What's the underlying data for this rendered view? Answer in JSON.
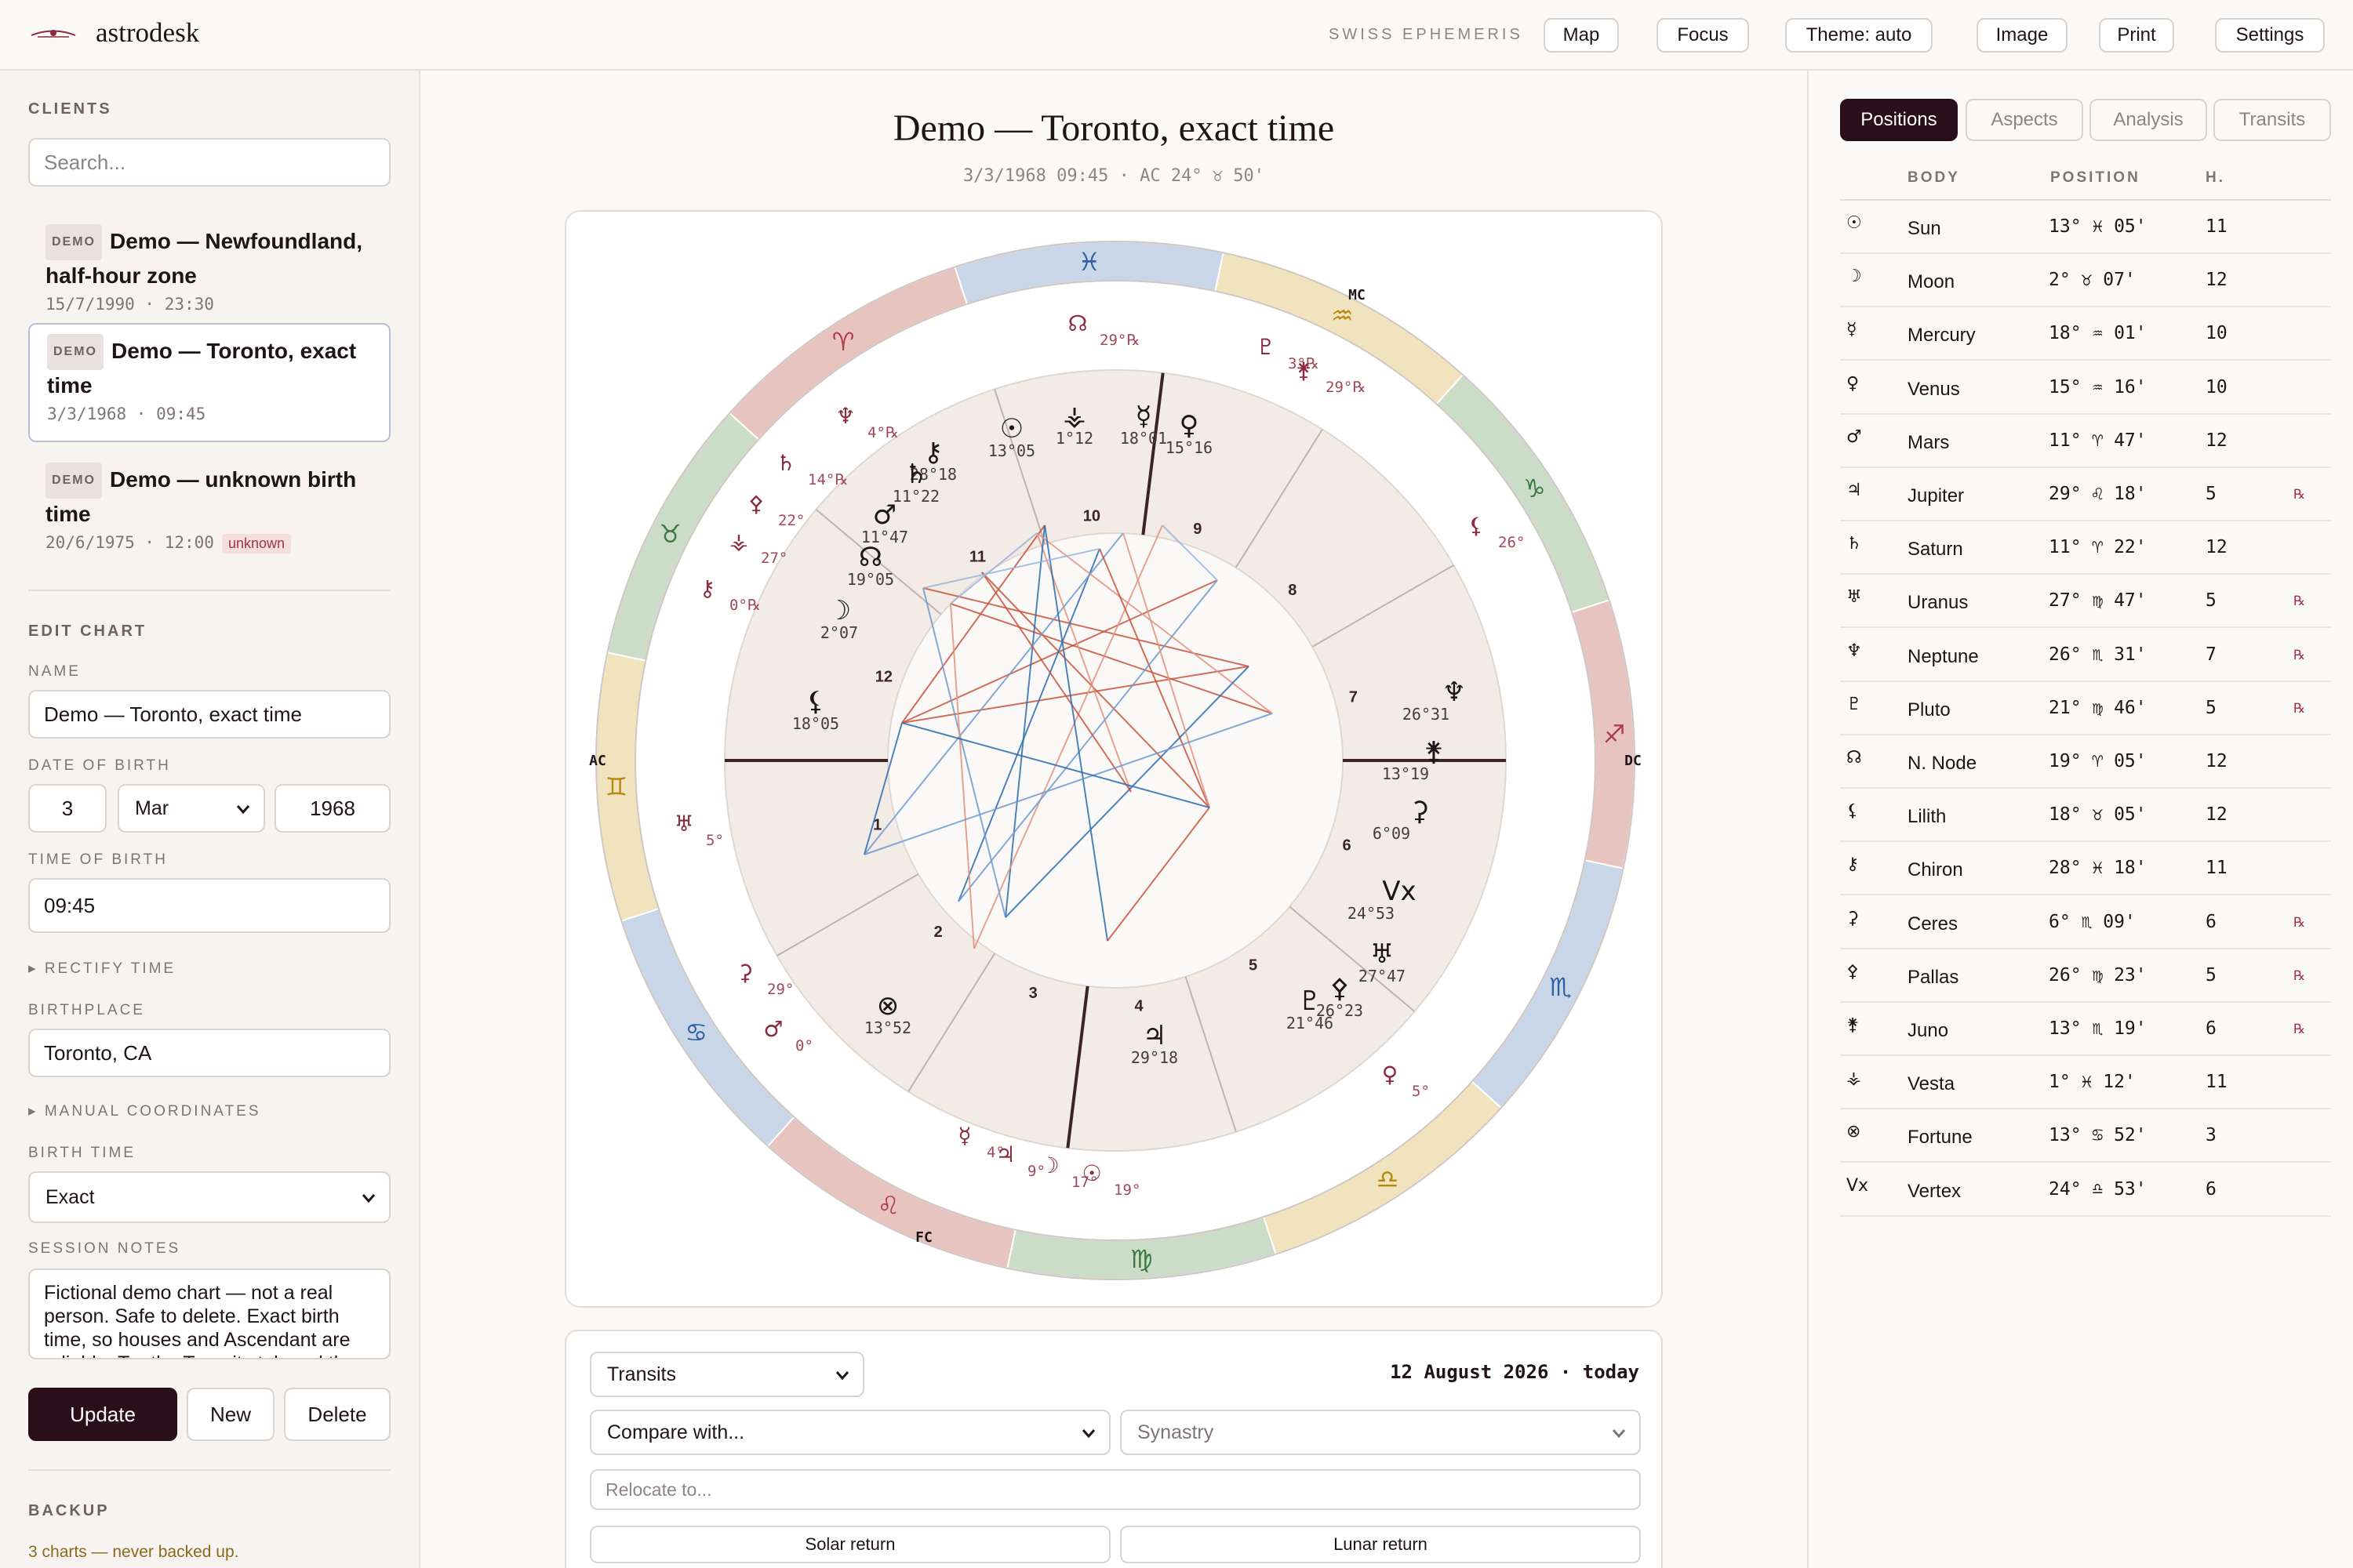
{
  "app": {
    "brand": "astrodesk",
    "ephemeris_label": "SWISS EPHEMERIS"
  },
  "topnav": {
    "map": "Map",
    "focus": "Focus",
    "theme": "Theme: auto",
    "image": "Image",
    "print": "Print",
    "settings": "Settings"
  },
  "sidebar": {
    "clients_title": "CLIENTS",
    "search_placeholder": "Search...",
    "clients": [
      {
        "badge": "DEMO",
        "name": "Demo — Newfoundland, half-hour zone",
        "date": "15/7/1990 · 23:30",
        "flag": ""
      },
      {
        "badge": "DEMO",
        "name": "Demo — Toronto, exact time",
        "date": "3/3/1968 · 09:45",
        "flag": ""
      },
      {
        "badge": "DEMO",
        "name": "Demo — unknown birth time",
        "date": "20/6/1975 · 12:00",
        "flag": "unknown"
      }
    ],
    "edit_title": "EDIT CHART",
    "name_label": "NAME",
    "name_value": "Demo — Toronto, exact time",
    "dob_label": "DATE OF BIRTH",
    "dob_day": "3",
    "dob_month": "Mar",
    "dob_year": "1968",
    "tob_label": "TIME OF BIRTH",
    "tob_value": "09:45",
    "rectify_label": "RECTIFY TIME",
    "birthplace_label": "BIRTHPLACE",
    "birthplace_value": "Toronto, CA",
    "manual_coords_label": "MANUAL COORDINATES",
    "birth_time_label": "BIRTH TIME",
    "birth_time_value": "Exact",
    "notes_label": "SESSION NOTES",
    "notes_value": "Fictional demo chart — not a real person. Safe to delete. Exact birth time, so houses and Ascendant are reliable. Try the Transits tab and the",
    "update_label": "Update",
    "new_label": "New",
    "delete_label": "Delete",
    "backup_title": "BACKUP",
    "backup_status": "3 charts — never backed up."
  },
  "main": {
    "title": "Demo — Toronto, exact time",
    "subtitle": "3/3/1968 09:45 · AC 24° ♉ 50'",
    "bottom": {
      "mode_select": "Transits",
      "date_label": "12 August 2026 · today",
      "compare_select": "Compare with...",
      "synastry_select": "Synastry",
      "relocate_placeholder": "Relocate to...",
      "solar_return": "Solar return",
      "lunar_return": "Lunar return"
    }
  },
  "wheel": {
    "angle_labels": {
      "ac": "AC",
      "dc": "DC",
      "mc": "MC",
      "fc": "FC"
    },
    "zodiac": [
      "♈",
      "♉",
      "♊",
      "♋",
      "♌",
      "♍",
      "♎",
      "♏",
      "♐",
      "♑",
      "♒",
      "♓"
    ],
    "zodiac_colors": [
      "#e8c4c0",
      "#cbdcc9",
      "#f0e3bd",
      "#c9d6e8"
    ],
    "zodiac_glyph_colors": [
      "#b23a48",
      "#3b7a3e",
      "#b58a12",
      "#2f5fa3"
    ],
    "houses": [
      "1",
      "2",
      "3",
      "4",
      "5",
      "6",
      "7",
      "8",
      "9",
      "10",
      "11",
      "12"
    ],
    "natal_labels": [
      {
        "g": "☉",
        "t": "13°05"
      },
      {
        "g": "⚶",
        "t": "1°12"
      },
      {
        "g": "☿",
        "t": "18°01"
      },
      {
        "g": "♀",
        "t": "15°16"
      },
      {
        "g": "⚷",
        "t": "28°18"
      },
      {
        "g": "♄",
        "t": "11°22"
      },
      {
        "g": "♂",
        "t": "11°47"
      },
      {
        "g": "☊",
        "t": "19°05"
      },
      {
        "g": "☽",
        "t": "2°07"
      },
      {
        "g": "⚸",
        "t": "18°05"
      },
      {
        "g": "♆",
        "t": "26°31"
      },
      {
        "g": "⚵",
        "t": "13°19"
      },
      {
        "g": "⚳",
        "t": "6°09"
      },
      {
        "g": "Vx",
        "t": "24°53"
      },
      {
        "g": "♅",
        "t": "27°47"
      },
      {
        "g": "⚴",
        "t": "26°23"
      },
      {
        "g": "♇",
        "t": "21°46"
      },
      {
        "g": "♃",
        "t": "29°18"
      },
      {
        "g": "⊗",
        "t": "13°52"
      }
    ],
    "transit_labels": [
      {
        "g": "☊",
        "t": "29°℞"
      },
      {
        "g": "♇",
        "t": "3°℞"
      },
      {
        "g": "⚵",
        "t": "29°℞"
      },
      {
        "g": "♆",
        "t": "4°℞"
      },
      {
        "g": "♄",
        "t": "14°℞"
      },
      {
        "g": "⚴",
        "t": "22°"
      },
      {
        "g": "⚶",
        "t": "27°"
      },
      {
        "g": "⚷",
        "t": "0°℞"
      },
      {
        "g": "⚸",
        "t": "26°"
      },
      {
        "g": "♅",
        "t": "5°"
      },
      {
        "g": "⚳",
        "t": "29°"
      },
      {
        "g": "♂",
        "t": "0°"
      },
      {
        "g": "☿",
        "t": "4°"
      },
      {
        "g": "♃",
        "t": "9°"
      },
      {
        "g": "☽",
        "t": "17°"
      },
      {
        "g": "☉",
        "t": "19°"
      },
      {
        "g": "♀",
        "t": "5°"
      }
    ],
    "retro_mark": "℞"
  },
  "panel": {
    "tabs": [
      "Positions",
      "Aspects",
      "Analysis",
      "Transits"
    ],
    "headers": {
      "body": "BODY",
      "position": "POSITION",
      "house": "H."
    },
    "rows": [
      {
        "glyph": "☉",
        "body": "Sun",
        "pos": "13° ♓ 05'",
        "house": "11",
        "r": ""
      },
      {
        "glyph": "☽",
        "body": "Moon",
        "pos": "2° ♉ 07'",
        "house": "12",
        "r": ""
      },
      {
        "glyph": "☿",
        "body": "Mercury",
        "pos": "18° ♒ 01'",
        "house": "10",
        "r": ""
      },
      {
        "glyph": "♀",
        "body": "Venus",
        "pos": "15° ♒ 16'",
        "house": "10",
        "r": ""
      },
      {
        "glyph": "♂",
        "body": "Mars",
        "pos": "11° ♈ 47'",
        "house": "12",
        "r": ""
      },
      {
        "glyph": "♃",
        "body": "Jupiter",
        "pos": "29° ♌ 18'",
        "house": "5",
        "r": "℞"
      },
      {
        "glyph": "♄",
        "body": "Saturn",
        "pos": "11° ♈ 22'",
        "house": "12",
        "r": ""
      },
      {
        "glyph": "♅",
        "body": "Uranus",
        "pos": "27° ♍ 47'",
        "house": "5",
        "r": "℞"
      },
      {
        "glyph": "♆",
        "body": "Neptune",
        "pos": "26° ♏ 31'",
        "house": "7",
        "r": "℞"
      },
      {
        "glyph": "♇",
        "body": "Pluto",
        "pos": "21° ♍ 46'",
        "house": "5",
        "r": "℞"
      },
      {
        "glyph": "☊",
        "body": "N. Node",
        "pos": "19° ♈ 05'",
        "house": "12",
        "r": ""
      },
      {
        "glyph": "⚸",
        "body": "Lilith",
        "pos": "18° ♉ 05'",
        "house": "12",
        "r": ""
      },
      {
        "glyph": "⚷",
        "body": "Chiron",
        "pos": "28° ♓ 18'",
        "house": "11",
        "r": ""
      },
      {
        "glyph": "⚳",
        "body": "Ceres",
        "pos": "6° ♏ 09'",
        "house": "6",
        "r": "℞"
      },
      {
        "glyph": "⚴",
        "body": "Pallas",
        "pos": "26° ♍ 23'",
        "house": "5",
        "r": "℞"
      },
      {
        "glyph": "⚵",
        "body": "Juno",
        "pos": "13° ♏ 19'",
        "house": "6",
        "r": "℞"
      },
      {
        "glyph": "⚶",
        "body": "Vesta",
        "pos": "1° ♓ 12'",
        "house": "11",
        "r": ""
      },
      {
        "glyph": "⊗",
        "body": "Fortune",
        "pos": "13° ♋ 52'",
        "house": "3",
        "r": ""
      },
      {
        "glyph": "Vx",
        "body": "Vertex",
        "pos": "24° ♎ 53'",
        "house": "6",
        "r": ""
      }
    ]
  }
}
